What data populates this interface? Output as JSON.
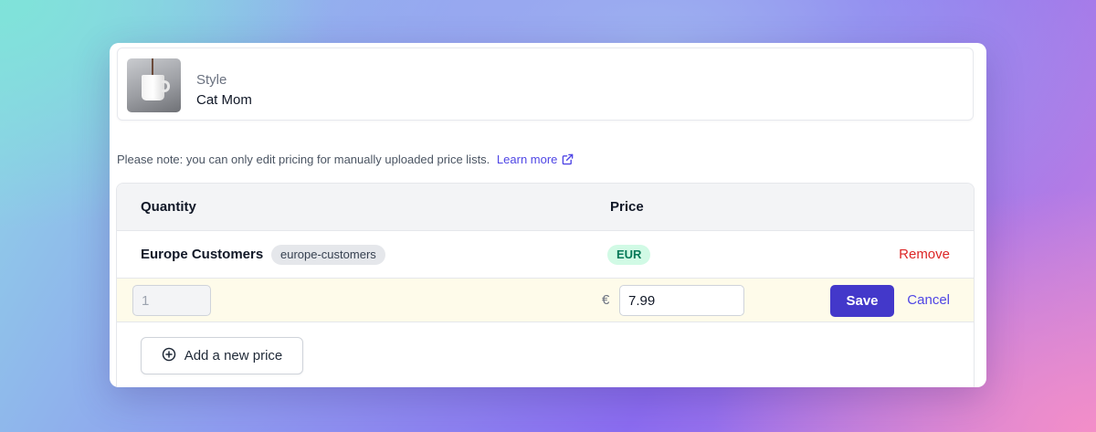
{
  "product": {
    "style_label": "Style",
    "style_value": "Cat Mom",
    "thumbnail_icon": "mug-photo"
  },
  "note": {
    "text": "Please note: you can only edit pricing for manually uploaded price lists.",
    "link_label": "Learn more",
    "link_icon": "external-link-icon"
  },
  "table": {
    "columns": [
      "Quantity",
      "Price"
    ],
    "group": {
      "name": "Europe Customers",
      "tag": "europe-customers",
      "currency": "EUR",
      "remove_label": "Remove"
    },
    "edit_row": {
      "quantity_value": "1",
      "currency_symbol": "€",
      "price_value": "7.99",
      "save_label": "Save",
      "cancel_label": "Cancel"
    },
    "add_label": "Add a new price",
    "add_icon": "plus-circle-icon"
  },
  "colors": {
    "accent": "#4338ca",
    "link": "#4f46e5",
    "danger": "#dc2626",
    "currency_badge_bg": "#d1fae5",
    "edit_row_bg": "#fefbea"
  }
}
